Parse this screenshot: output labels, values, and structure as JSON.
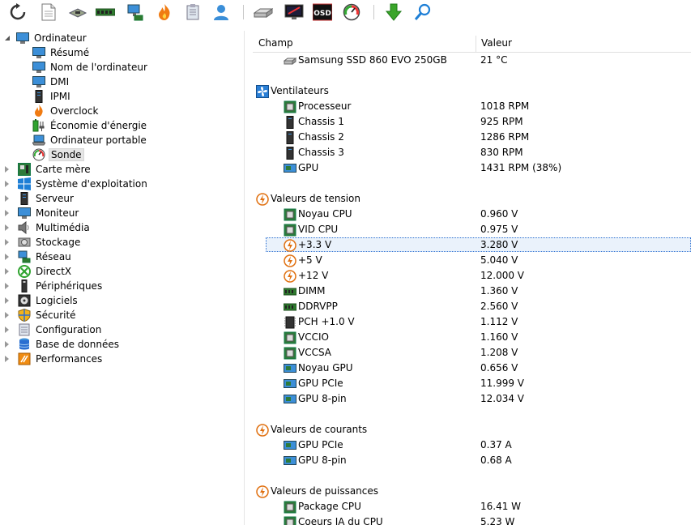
{
  "toolbar": {
    "buttons": [
      {
        "name": "refresh-icon"
      },
      {
        "name": "report-icon"
      },
      {
        "name": "memory-module-icon"
      },
      {
        "name": "ram-stick-icon"
      },
      {
        "name": "network-icon"
      },
      {
        "name": "flame-icon"
      },
      {
        "name": "tools-icon"
      },
      {
        "name": "user-icon"
      },
      {
        "name": "drive-icon"
      },
      {
        "name": "monitor-icon"
      },
      {
        "name": "osd-icon",
        "label": "OSD"
      },
      {
        "name": "gauge-icon"
      },
      {
        "name": "download-arrow-icon"
      },
      {
        "name": "search-icon"
      }
    ]
  },
  "tree": {
    "root": "Ordinateur",
    "children": [
      "Résumé",
      "Nom de l'ordinateur",
      "DMI",
      "IPMI",
      "Overclock",
      "Économie d'énergie",
      "Ordinateur portable",
      "Sonde"
    ],
    "selected": "Sonde",
    "categories": [
      "Carte mère",
      "Système d'exploitation",
      "Serveur",
      "Moniteur",
      "Multimédia",
      "Stockage",
      "Réseau",
      "DirectX",
      "Périphériques",
      "Logiciels",
      "Sécurité",
      "Configuration",
      "Base de données",
      "Performances"
    ]
  },
  "table": {
    "col_field": "Champ",
    "col_value": "Valeur",
    "top_row": {
      "field": "Samsung SSD 860 EVO 250GB",
      "value": "21 °C"
    },
    "groups": [
      {
        "title": "Ventilateurs",
        "rows": [
          {
            "field": "Processeur",
            "value": "1018 RPM"
          },
          {
            "field": "Chassis 1",
            "value": "925 RPM"
          },
          {
            "field": "Chassis 2",
            "value": "1286 RPM"
          },
          {
            "field": "Chassis 3",
            "value": "830 RPM"
          },
          {
            "field": "GPU",
            "value": "1431 RPM  (38%)"
          }
        ]
      },
      {
        "title": "Valeurs de tension",
        "rows": [
          {
            "field": "Noyau CPU",
            "value": "0.960 V"
          },
          {
            "field": "VID CPU",
            "value": "0.975 V"
          },
          {
            "field": "+3.3 V",
            "value": "3.280 V"
          },
          {
            "field": "+5 V",
            "value": "5.040 V"
          },
          {
            "field": "+12 V",
            "value": "12.000 V"
          },
          {
            "field": "DIMM",
            "value": "1.360 V"
          },
          {
            "field": "DDRVPP",
            "value": "2.560 V"
          },
          {
            "field": "PCH +1.0 V",
            "value": "1.112 V"
          },
          {
            "field": "VCCIO",
            "value": "1.160 V"
          },
          {
            "field": "VCCSA",
            "value": "1.208 V"
          },
          {
            "field": "Noyau GPU",
            "value": "0.656 V"
          },
          {
            "field": "GPU PCIe",
            "value": "11.999 V"
          },
          {
            "field": "GPU 8-pin",
            "value": "12.034 V"
          }
        ]
      },
      {
        "title": "Valeurs de courants",
        "rows": [
          {
            "field": "GPU PCIe",
            "value": "0.37 A"
          },
          {
            "field": "GPU 8-pin",
            "value": "0.68 A"
          }
        ]
      },
      {
        "title": "Valeurs de puissances",
        "rows": [
          {
            "field": "Package CPU",
            "value": "16.41 W"
          },
          {
            "field": "Coeurs IA du CPU",
            "value": "5.23 W"
          }
        ]
      }
    ]
  },
  "colors": {
    "selection_border": "#2a6ed1",
    "selection_fill": "#eaf2fb",
    "accent_blue": "#1e7fd6",
    "arrow_green": "#3aa52a"
  }
}
